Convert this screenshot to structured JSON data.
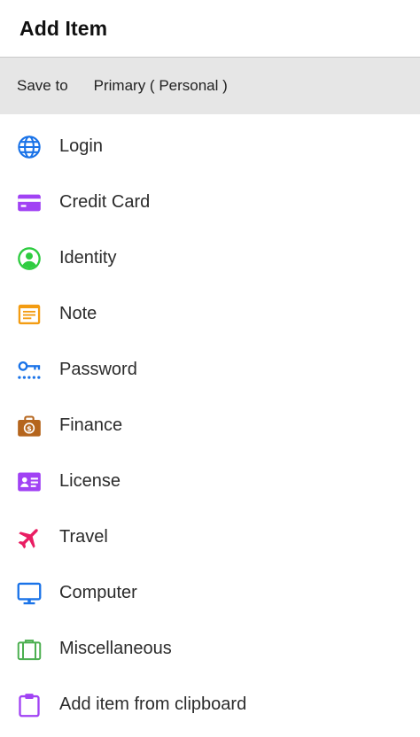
{
  "header": {
    "title": "Add Item"
  },
  "save_to": {
    "label": "Save to",
    "value": "Primary ( Personal )"
  },
  "items": [
    {
      "label": "Login",
      "icon": "globe-icon",
      "color": "#1a73e8"
    },
    {
      "label": "Credit Card",
      "icon": "credit-card-icon",
      "color": "#a142f4"
    },
    {
      "label": "Identity",
      "icon": "identity-icon",
      "color": "#2ecc40"
    },
    {
      "label": "Note",
      "icon": "note-icon",
      "color": "#f39c12"
    },
    {
      "label": "Password",
      "icon": "password-key-icon",
      "color": "#1a73e8"
    },
    {
      "label": "Finance",
      "icon": "finance-briefcase-icon",
      "color": "#b5651d"
    },
    {
      "label": "License",
      "icon": "license-card-icon",
      "color": "#a142f4"
    },
    {
      "label": "Travel",
      "icon": "airplane-icon",
      "color": "#e91e63"
    },
    {
      "label": "Computer",
      "icon": "monitor-icon",
      "color": "#1a73e8"
    },
    {
      "label": "Miscellaneous",
      "icon": "suitcase-icon",
      "color": "#4caf50"
    },
    {
      "label": "Add item from clipboard",
      "icon": "clipboard-icon",
      "color": "#a142f4"
    }
  ]
}
